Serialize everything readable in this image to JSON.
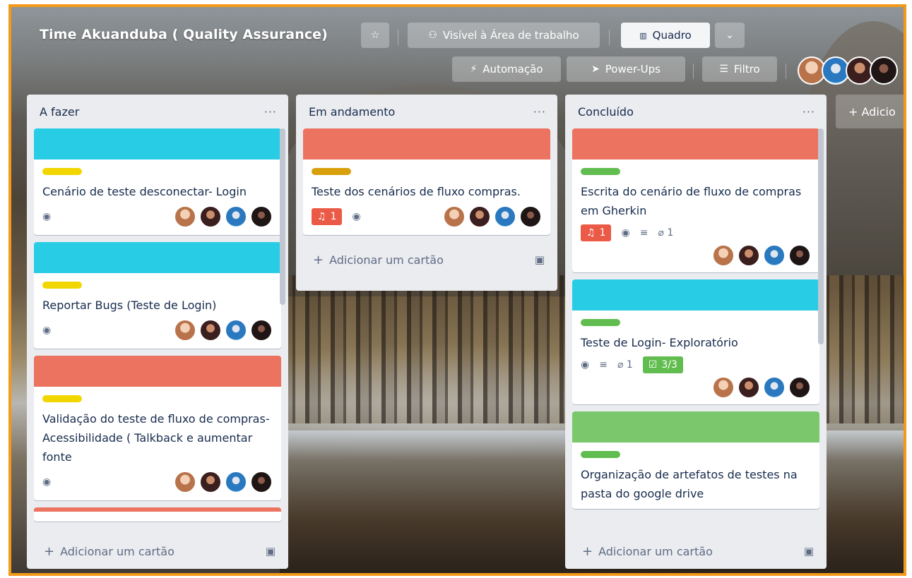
{
  "board": {
    "title": "Time Akuanduba ( Quality Assurance)",
    "visibility": "Visível à Área de trabalho",
    "view": "Quadro",
    "automation": "Automação",
    "powerups": "Power-Ups",
    "filter": "Filtro",
    "add_list": "+ Adicio"
  },
  "icons": {
    "star": "star-icon",
    "visibility": "people-icon",
    "board_view": "board-icon",
    "chevron": "chevron-down-icon",
    "automation": "lightning-icon",
    "powerups": "rocket-icon",
    "filter": "filter-icon",
    "watch": "eye-icon",
    "description": "description-icon",
    "attachment": "paperclip-icon",
    "notification": "bell-icon",
    "checklist": "checklist-icon",
    "template": "card-template-icon"
  },
  "colors": {
    "cover_blue": "#29cce5",
    "cover_red": "#eb7360",
    "cover_green": "#7bc86c",
    "label_yellow": "#f2d600",
    "label_orange": "#d9a00d",
    "label_green": "#61bd4f",
    "badge_red": "#eb5a46",
    "badge_green": "#61bd4f"
  },
  "lists": [
    {
      "title": "A fazer",
      "menu": "···",
      "add_card": "Adicionar um cartão",
      "cards": [
        {
          "title": "Cenário de teste desconectar- Login"
        },
        {
          "title": "Reportar Bugs (Teste de Login)"
        },
        {
          "title": "Validação do teste de fluxo de compras- Acessibilidade ( Talkback e aumentar fonte"
        }
      ]
    },
    {
      "title": "Em andamento",
      "menu": "···",
      "add_card": "Adicionar um cartão",
      "cards": [
        {
          "title": "Teste dos cenários de fluxo compras.",
          "notifications": "1"
        }
      ]
    },
    {
      "title": "Concluído",
      "menu": "···",
      "add_card": "Adicionar um cartão",
      "cards": [
        {
          "title": "Escrita do cenário de fluxo de compras em Gherkin",
          "notifications": "1",
          "attachments": "1"
        },
        {
          "title": "Teste de Login- Exploratório",
          "attachments": "1",
          "checklist": "3/3"
        },
        {
          "title": "Organização de artefatos de testes na pasta do google drive"
        }
      ]
    }
  ]
}
